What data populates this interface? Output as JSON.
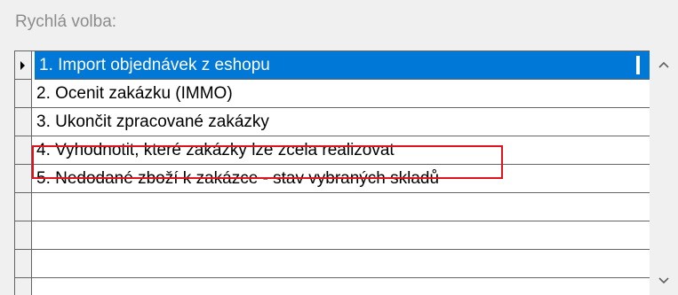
{
  "panel": {
    "title": "Rychlá volba:"
  },
  "list": {
    "items": [
      {
        "label": "1. Import objednávek z eshopu",
        "selected": true
      },
      {
        "label": "2. Ocenit zakázku (IMMO)",
        "selected": false
      },
      {
        "label": "3. Ukončit zpracované zakázky",
        "selected": false
      },
      {
        "label": "4. Vyhodnotit, které zakázky lze zcela realizovat",
        "selected": false,
        "highlighted": true
      },
      {
        "label": "5. Nedodané zboží k zakázce - stav vybraných skladů",
        "selected": false
      },
      {
        "label": "",
        "selected": false
      },
      {
        "label": "",
        "selected": false
      },
      {
        "label": "",
        "selected": false
      }
    ]
  },
  "scrollbar": {
    "up_icon": "chevron-up-icon",
    "down_icon": "chevron-down-icon"
  },
  "colors": {
    "selection": "#0078d7",
    "highlight_box": "#e0121b",
    "grid_line": "#646464"
  }
}
